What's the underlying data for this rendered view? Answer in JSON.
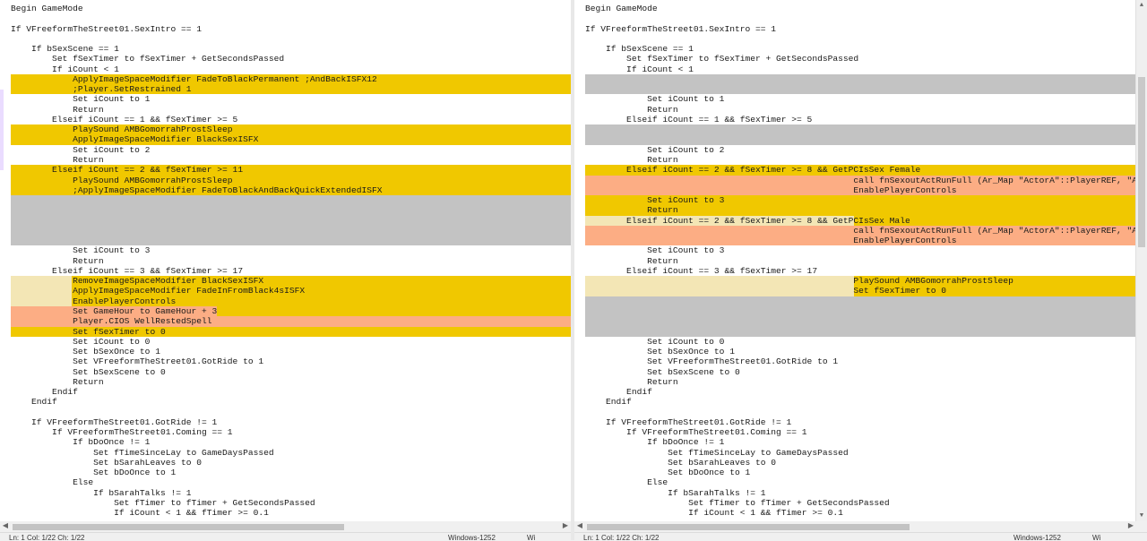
{
  "left_lines": [
    {
      "text": "Begin GameMode"
    },
    {
      "text": ""
    },
    {
      "text": "If VFreeformTheStreet01.SexIntro == 1"
    },
    {
      "text": ""
    },
    {
      "text": "    If bSexScene == 1"
    },
    {
      "text": "        Set fSexTimer to fSexTimer + GetSecondsPassed"
    },
    {
      "text": "        If iCount < 1"
    },
    {
      "text": "            ApplyImageSpaceModifier FadeToBlackPermanent ;AndBackISFX12",
      "bg": "changed"
    },
    {
      "text": "            ;Player.SetRestrained 1",
      "bg": "changed"
    },
    {
      "text": "            Set iCount to 1"
    },
    {
      "text": "            Return"
    },
    {
      "text": "        Elseif iCount == 1 && fSexTimer >= 5"
    },
    {
      "text": "            PlaySound AMBGomorrahProstSleep",
      "bg": "changed"
    },
    {
      "text": "            ApplyImageSpaceModifier BlackSexISFX",
      "bg": "changed"
    },
    {
      "text": "            Set iCount to 2"
    },
    {
      "text": "            Return"
    },
    {
      "text": "        Elseif iCount == 2 && fSexTimer >= 11",
      "bg": "changed"
    },
    {
      "text": "            PlaySound AMBGomorrahProstSleep",
      "bg": "changed"
    },
    {
      "text": "            ;ApplyImageSpaceModifier FadeToBlackAndBackQuickExtendedISFX",
      "bg": "changed"
    },
    {
      "text": "",
      "bg": "empty"
    },
    {
      "text": "",
      "bg": "empty"
    },
    {
      "text": "",
      "bg": "empty"
    },
    {
      "text": "",
      "bg": "empty"
    },
    {
      "text": "",
      "bg": "empty"
    },
    {
      "text": "            Set iCount to 3"
    },
    {
      "text": "            Return"
    },
    {
      "text": "        Elseif iCount == 3 && fSexTimer >= 17"
    },
    {
      "text": "            RemoveImageSpaceModifier BlackSexISFX",
      "bg": "changed",
      "edge": "light"
    },
    {
      "text": "            ApplyImageSpaceModifier FadeInFromBlack4sISFX",
      "bg": "changed",
      "edge": "light"
    },
    {
      "text": "            EnablePlayerControls",
      "bg": "changed",
      "edge": "light"
    },
    {
      "text": "            Set GameHour to GameHour + 3",
      "bg": "changed",
      "inline": "salmon"
    },
    {
      "text": "            Player.CIOS WellRestedSpell",
      "bg": "salmon"
    },
    {
      "text": "            Set fSexTimer to 0",
      "bg": "changed"
    },
    {
      "text": "            Set iCount to 0"
    },
    {
      "text": "            Set bSexOnce to 1"
    },
    {
      "text": "            Set VFreeformTheStreet01.GotRide to 1"
    },
    {
      "text": "            Set bSexScene to 0"
    },
    {
      "text": "            Return"
    },
    {
      "text": "        Endif"
    },
    {
      "text": "    Endif"
    },
    {
      "text": ""
    },
    {
      "text": "    If VFreeformTheStreet01.GotRide != 1"
    },
    {
      "text": "        If VFreeformTheStreet01.Coming == 1"
    },
    {
      "text": "            If bDoOnce != 1"
    },
    {
      "text": "                Set fTimeSinceLay to GameDaysPassed"
    },
    {
      "text": "                Set bSarahLeaves to 0"
    },
    {
      "text": "                Set bDoOnce to 1"
    },
    {
      "text": "            Else"
    },
    {
      "text": "                If bSarahTalks != 1"
    },
    {
      "text": "                    Set fTimer to fTimer + GetSecondsPassed"
    },
    {
      "text": "                    If iCount < 1 && fTimer >= 0.1"
    }
  ],
  "right_lines": [
    {
      "text": "Begin GameMode"
    },
    {
      "text": ""
    },
    {
      "text": "If VFreeformTheStreet01.SexIntro == 1"
    },
    {
      "text": ""
    },
    {
      "text": "    If bSexScene == 1"
    },
    {
      "text": "        Set fSexTimer to fSexTimer + GetSecondsPassed"
    },
    {
      "text": "        If iCount < 1"
    },
    {
      "text": "",
      "bg": "empty"
    },
    {
      "text": "",
      "bg": "empty"
    },
    {
      "text": "            Set iCount to 1"
    },
    {
      "text": "            Return"
    },
    {
      "text": "        Elseif iCount == 1 && fSexTimer >= 5"
    },
    {
      "text": "",
      "bg": "empty"
    },
    {
      "text": "",
      "bg": "empty"
    },
    {
      "text": "            Set iCount to 2"
    },
    {
      "text": "            Return"
    },
    {
      "text": "        Elseif iCount == 2 && fSexTimer >= 8 && GetPCIsSex Female",
      "bg": "changed"
    },
    {
      "text": "                                                    call fnSexoutActRunFull (Ar_Map \"ActorA\"::PlayerREF, \"ActorB\"::SexPartnerRef)",
      "bg": "salmon"
    },
    {
      "text": "                                                    EnablePlayerControls",
      "bg": "salmon"
    },
    {
      "text": "            Set iCount to 3",
      "bg": "changed"
    },
    {
      "text": "            Return",
      "bg": "changed"
    },
    {
      "text": "        Elseif iCount == 2 && fSexTimer >= 8 && GetPCIsSex Male",
      "bg": "changed",
      "edge": "light"
    },
    {
      "text": "                                                    call fnSexoutActRunFull (Ar_Map \"ActorA\"::PlayerREF, \"ActorB\"::SexPartnerRef)",
      "bg": "salmon"
    },
    {
      "text": "                                                    EnablePlayerControls",
      "bg": "salmon"
    },
    {
      "text": "            Set iCount to 3"
    },
    {
      "text": "            Return"
    },
    {
      "text": "        Elseif iCount == 3 && fSexTimer >= 17"
    },
    {
      "text": "                                                    PlaySound AMBGomorrahProstSleep",
      "bg": "changed",
      "edge": "light"
    },
    {
      "text": "                                                    Set fSexTimer to 0",
      "bg": "changed",
      "edge": "light"
    },
    {
      "text": "",
      "bg": "empty"
    },
    {
      "text": "",
      "bg": "empty"
    },
    {
      "text": "",
      "bg": "empty"
    },
    {
      "text": "",
      "bg": "empty"
    },
    {
      "text": "            Set iCount to 0"
    },
    {
      "text": "            Set bSexOnce to 1"
    },
    {
      "text": "            Set VFreeformTheStreet01.GotRide to 1"
    },
    {
      "text": "            Set bSexScene to 0"
    },
    {
      "text": "            Return"
    },
    {
      "text": "        Endif"
    },
    {
      "text": "    Endif"
    },
    {
      "text": ""
    },
    {
      "text": "    If VFreeformTheStreet01.GotRide != 1"
    },
    {
      "text": "        If VFreeformTheStreet01.Coming == 1"
    },
    {
      "text": "            If bDoOnce != 1"
    },
    {
      "text": "                Set fTimeSinceLay to GameDaysPassed"
    },
    {
      "text": "                Set bSarahLeaves to 0"
    },
    {
      "text": "                Set bDoOnce to 1"
    },
    {
      "text": "            Else"
    },
    {
      "text": "                If bSarahTalks != 1"
    },
    {
      "text": "                    Set fTimer to fTimer + GetSecondsPassed"
    },
    {
      "text": "                    If iCount < 1 && fTimer >= 0.1"
    }
  ],
  "statusbar": {
    "left": {
      "position": "Ln: 1  Col: 1/22  Ch: 1/22",
      "encoding": "Windows-1252",
      "eol": "Wi"
    },
    "right": {
      "position": "Ln: 1  Col: 1/22  Ch: 1/22",
      "encoding": "Windows-1252",
      "eol": "Wi"
    }
  },
  "icons": {
    "scroll_left": "◀",
    "scroll_right": "▶",
    "scroll_up": "▲",
    "scroll_down": "▼"
  },
  "colors": {
    "changed": "#f0c800",
    "empty": "#c3c3c3",
    "light": "#f3e6b5",
    "salmon": "#fcad84"
  }
}
